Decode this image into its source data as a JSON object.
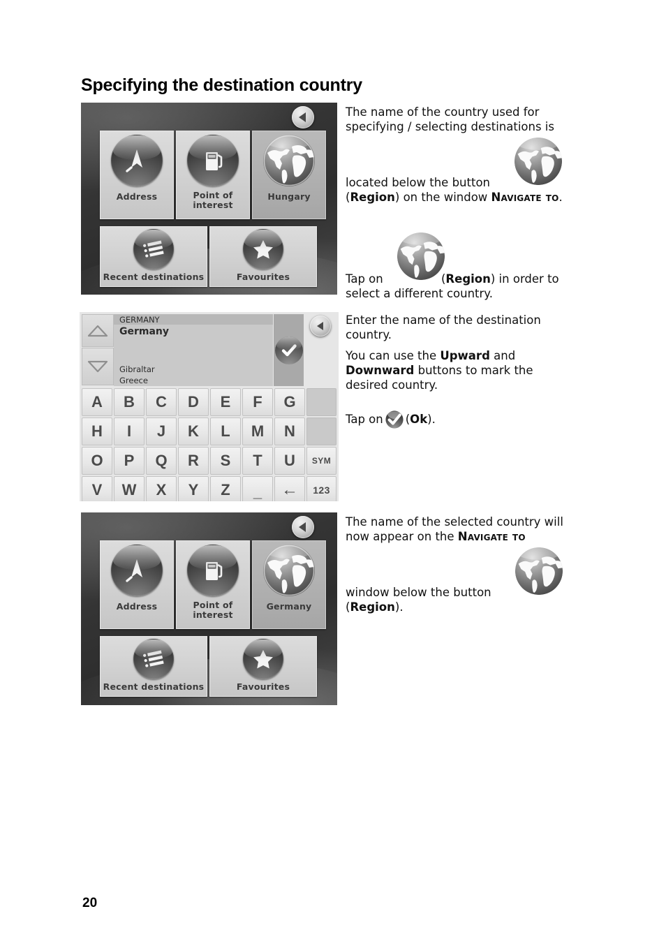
{
  "page": {
    "title": "Specifying the destination country",
    "number": "20"
  },
  "screens": {
    "navigate_to_hungary": {
      "name": "Navigate to",
      "back_button": "back-arrow",
      "tiles": [
        {
          "label": "Address",
          "icon": "location-arrow-icon",
          "selected": false
        },
        {
          "label": "Point of\ninterest",
          "label_line1": "Point of",
          "label_line2": "interest",
          "icon": "fuel-pump-icon",
          "selected": false
        },
        {
          "label": "Hungary",
          "icon": "globe-icon",
          "selected": true
        },
        {
          "label": "Recent destinations",
          "icon": "list-icon",
          "selected": false
        },
        {
          "label": "Favourites",
          "icon": "star-icon",
          "selected": false
        }
      ]
    },
    "country_keyboard": {
      "typed_text": "GERMANY",
      "match": "Germany",
      "suggestions": [
        "Gibraltar",
        "Greece"
      ],
      "up_button": "upward-button",
      "down_button": "downward-button",
      "ok_button": "Ok",
      "back_button": "back-arrow",
      "keyboard_rows": [
        [
          "A",
          "B",
          "C",
          "D",
          "E",
          "F",
          "G",
          ""
        ],
        [
          "H",
          "I",
          "J",
          "K",
          "L",
          "M",
          "N",
          ""
        ],
        [
          "O",
          "P",
          "Q",
          "R",
          "S",
          "T",
          "U",
          "SYM"
        ],
        [
          "V",
          "W",
          "X",
          "Y",
          "Z",
          "_",
          "←",
          "123"
        ]
      ]
    },
    "navigate_to_germany": {
      "name": "Navigate to",
      "back_button": "back-arrow",
      "tiles": [
        {
          "label": "Address",
          "icon": "location-arrow-icon",
          "selected": false
        },
        {
          "label": "Point of\ninterest",
          "label_line1": "Point of",
          "label_line2": "interest",
          "icon": "fuel-pump-icon",
          "selected": false
        },
        {
          "label": "Germany",
          "icon": "globe-icon",
          "selected": true
        },
        {
          "label": "Recent destinations",
          "icon": "list-icon",
          "selected": false
        },
        {
          "label": "Favourites",
          "icon": "star-icon",
          "selected": false
        }
      ]
    }
  },
  "body": {
    "block1": {
      "line1": "The name of the country used for",
      "line2": "specifying / selecting destinations is",
      "line3": "located below the button",
      "line4_a": "(",
      "line4_region": "Region",
      "line4_b": ") on the window ",
      "line4_window": "Navigate to",
      "line4_c": "."
    },
    "block2": {
      "tap_a": "Tap on",
      "tap_b": "(",
      "tap_region": "Region",
      "tap_c": ") in order to",
      "tap_d": "select a different country."
    },
    "block3": {
      "line1": "Enter the name of the destination",
      "line2": "country.",
      "p2_a": "You can use the ",
      "p2_upward": "Upward",
      "p2_b": " and",
      "p2_downward": "Downward",
      "p2_c": " buttons to mark the",
      "p2_d": "desired country.",
      "p3_a": "Tap on",
      "p3_b": "(",
      "p3_ok": "Ok",
      "p3_c": ")."
    },
    "block4": {
      "line1": "The name of the selected country will",
      "line2_a": "now appear on the ",
      "line2_window": "Navigate to",
      "line3": "window below the button",
      "line4_a": "(",
      "line4_region": "Region",
      "line4_b": ")."
    }
  },
  "colors": {
    "page_bg": "#ffffff",
    "text": "#111111",
    "device_bg": "#3a3a3a",
    "tile_bg": "#d2d2d2",
    "tile_selected_bg": "#b1b1b1",
    "key_bg": "#e8e8e8",
    "key_text": "#4a4a4a",
    "list_bg": "#c9c9c9"
  }
}
